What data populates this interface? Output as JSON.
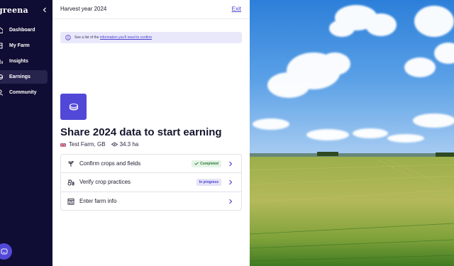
{
  "sidebar": {
    "logo": "greena",
    "items": [
      {
        "label": "Dashboard",
        "icon": "dashboard-icon",
        "active": false
      },
      {
        "label": "My Farm",
        "icon": "farm-icon",
        "active": false
      },
      {
        "label": "Insights",
        "icon": "insights-icon",
        "active": false
      },
      {
        "label": "Earnings",
        "icon": "coin-icon",
        "active": true
      },
      {
        "label": "Community",
        "icon": "community-icon",
        "active": false
      }
    ],
    "chat_icon": "chat-icon"
  },
  "header": {
    "title": "Harvest year 2024",
    "exit_label": "Exit"
  },
  "notice": {
    "text_before": "See a list of the ",
    "link_text": "information you'll need to confirm"
  },
  "hero": {
    "icon": "coin-stack-icon",
    "heading": "Share 2024 data to start earning",
    "farm_label": "Test Farm, GB",
    "area_label": "34.3 ha"
  },
  "tasks": [
    {
      "label": "Confirm crops and fields",
      "status": "Completed",
      "icon": "crop-icon"
    },
    {
      "label": "Verify crop practices",
      "status": "In progress",
      "icon": "tractor-icon"
    },
    {
      "label": "Enter farm info",
      "status": "",
      "icon": "building-icon"
    }
  ],
  "colors": {
    "sidebar_bg": "#0f0d33",
    "accent": "#5248d8",
    "completed": "#2b7a39",
    "in_progress": "#4a3fd0"
  }
}
